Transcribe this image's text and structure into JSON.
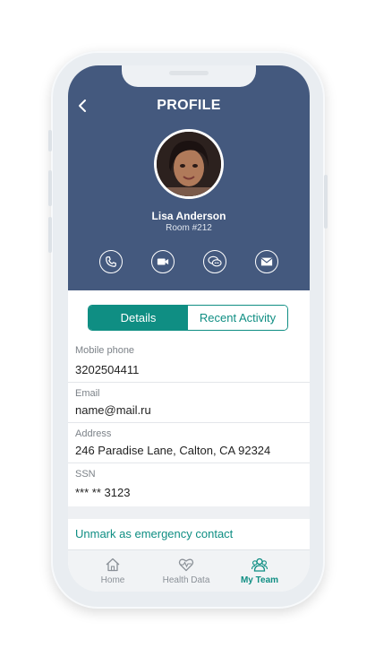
{
  "header": {
    "title": "PROFILE"
  },
  "profile": {
    "name": "Lisa Anderson",
    "room": "Room #212"
  },
  "actions": [
    "phone-icon",
    "video-icon",
    "chat-icon",
    "mail-icon"
  ],
  "tabs": {
    "details": "Details",
    "recent": "Recent Activity"
  },
  "fields": {
    "mobile": {
      "label": "Mobile phone",
      "value": "3202504411"
    },
    "email": {
      "label": "Email",
      "value": "name@mail.ru"
    },
    "address": {
      "label": "Address",
      "value": "246 Paradise Lane, Calton, CA 92324"
    },
    "ssn": {
      "label": "SSN",
      "value": "*** ** 3123"
    }
  },
  "emergency_link": "Unmark as emergency contact",
  "bottom_nav": {
    "home": "Home",
    "health": "Health Data",
    "team": "My Team"
  },
  "colors": {
    "header_bg": "#44597e",
    "accent": "#0f8e83"
  }
}
